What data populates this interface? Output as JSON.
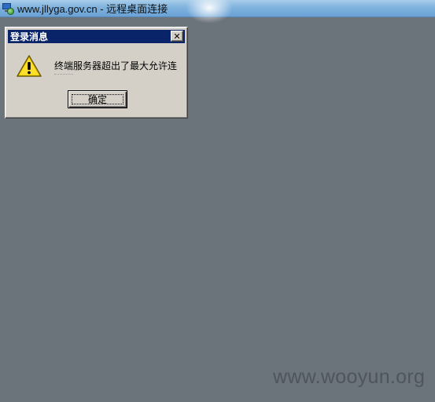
{
  "window": {
    "title": "www.jllyga.gov.cn - 远程桌面连接",
    "icon": "remote-desktop-icon"
  },
  "dialog": {
    "title": "登录消息",
    "close_label": "✕",
    "message": "终端服务器超出了最大允许连",
    "icon": "warning-icon",
    "ok_label": "确定"
  },
  "watermark": "www.wooyun.org",
  "colors": {
    "desktop": "#6b737b",
    "dialog_bg": "#d4d0c8",
    "dialog_title_bg": "#0a246a",
    "titlebar": "#7fb2dd"
  }
}
